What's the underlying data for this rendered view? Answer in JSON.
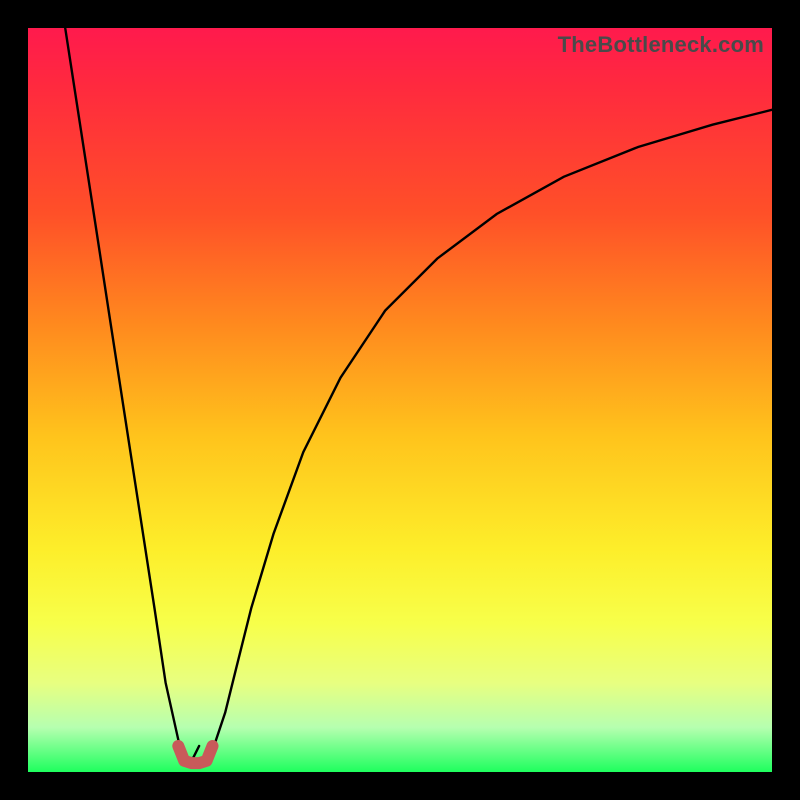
{
  "watermark": {
    "text": "TheBottleneck.com"
  },
  "chart_data": {
    "type": "line",
    "title": "",
    "xlabel": "",
    "ylabel": "",
    "xlim": [
      0,
      100
    ],
    "ylim": [
      0,
      100
    ],
    "grid": false,
    "legend": false,
    "series": [
      {
        "name": "curve-left",
        "x": [
          5,
          7,
          9,
          11,
          13,
          15,
          17,
          18.5,
          20.5,
          22,
          23
        ],
        "values": [
          100,
          87,
          74,
          61,
          48,
          35,
          22,
          12,
          3,
          1.5,
          3.5
        ]
      },
      {
        "name": "curve-right",
        "x": [
          25,
          26.5,
          28,
          30,
          33,
          37,
          42,
          48,
          55,
          63,
          72,
          82,
          92,
          100
        ],
        "values": [
          3.5,
          8,
          14,
          22,
          32,
          43,
          53,
          62,
          69,
          75,
          80,
          84,
          87,
          89
        ]
      },
      {
        "name": "highlight-valley",
        "x": [
          20.2,
          21,
          22,
          23,
          24,
          24.8
        ],
        "values": [
          3.5,
          1.5,
          1.2,
          1.2,
          1.5,
          3.5
        ]
      }
    ],
    "colors": {
      "curve": "#000000",
      "highlight": "#c85a5a"
    }
  }
}
